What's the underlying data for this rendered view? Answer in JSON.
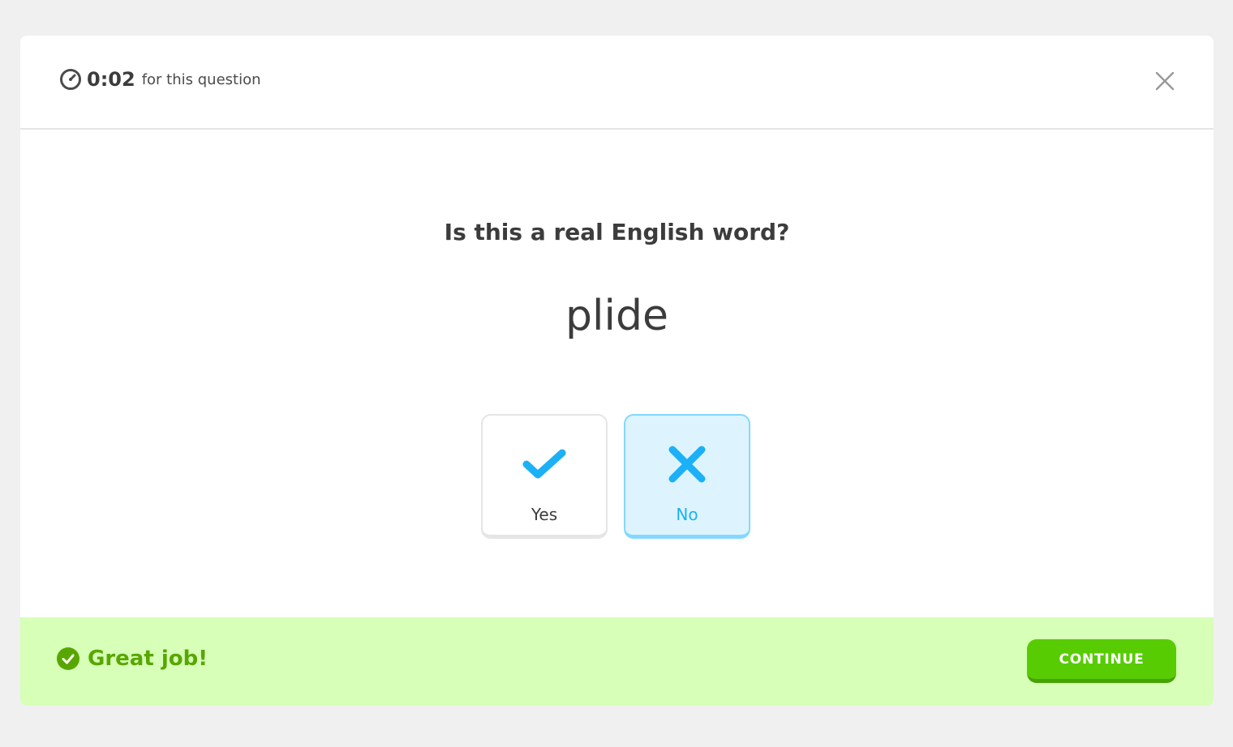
{
  "timer": {
    "value": "0:02",
    "label": "for this question",
    "icon": "stopwatch-icon"
  },
  "header": {
    "close_icon": "close-icon"
  },
  "question": {
    "prompt": "Is this a real English word?",
    "word": "plide"
  },
  "choices": [
    {
      "label": "Yes",
      "icon": "checkmark-icon",
      "selected": false
    },
    {
      "label": "No",
      "icon": "x-icon",
      "selected": true
    }
  ],
  "footer": {
    "feedback": "Great job!",
    "feedback_icon": "check-circle-icon",
    "continue_label": "CONTINUE"
  },
  "colors": {
    "accent_blue": "#1cb0f6",
    "selected_bg": "#ddf4ff",
    "selected_border": "#84d8ff",
    "success_bg": "#d7ffb8",
    "success_text": "#58a700",
    "button_green": "#58cc02",
    "button_green_shadow": "#46a302"
  }
}
